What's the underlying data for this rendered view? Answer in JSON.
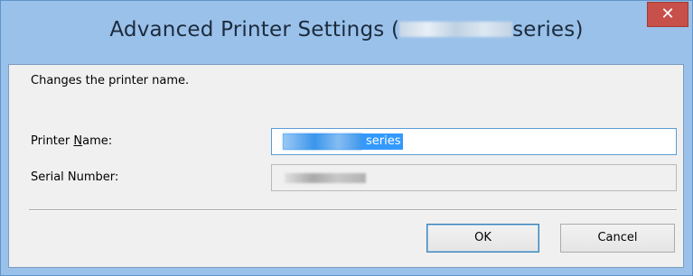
{
  "window": {
    "title_prefix": "Advanced Printer Settings (",
    "title_suffix": "series)",
    "close_glyph": "✕"
  },
  "dialog": {
    "description": "Changes the printer name.",
    "printer_name_label_pre": "Printer ",
    "printer_name_label_mnemonic": "N",
    "printer_name_label_post": "ame:",
    "printer_name_value_visible": "series",
    "serial_number_label": "Serial Number:"
  },
  "buttons": {
    "ok_label": "OK",
    "cancel_label": "Cancel"
  }
}
